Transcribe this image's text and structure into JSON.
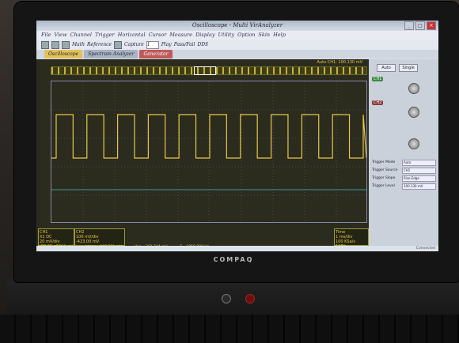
{
  "window": {
    "title": "Oscilloscope - Multi VirAnalyzer"
  },
  "menu": [
    "File",
    "View",
    "Channel",
    "Trigger",
    "Horizontal",
    "Cursor",
    "Measure",
    "Display",
    "Utility",
    "Option",
    "Skin",
    "Help"
  ],
  "toolbar": {
    "math_label": "Math",
    "reference_label": "Reference",
    "capture_label": "Capture",
    "capture_value": "1",
    "play_label": "Play",
    "passfail_label": "Pass/Fail",
    "dds_label": "DDS"
  },
  "tabs": [
    "Oscilloscope",
    "Spectrum Analyzer",
    "Generator"
  ],
  "scope": {
    "trigger_info": "Auto  CH1: 100.130 mV",
    "ch1": {
      "label": "CH1",
      "coupling": "X1  DC",
      "volt_div": "20 mV/div",
      "offset": "-80.00 mV"
    },
    "ch2": {
      "label": "CH2",
      "volt_div": "100 mV/div",
      "offset": "-423.00 mV"
    },
    "time": {
      "label": "Time",
      "time_div": "1 ms/div",
      "rate": "100 KSa/s",
      "mode": "12Bit"
    },
    "measurements": [
      "Vmean= -2.335 mV",
      "Vmax= 108.711 mV",
      "Vpp= 201.244 mV",
      "F= 1060.000 Hz"
    ]
  },
  "side": {
    "auto_label": "Auto",
    "single_label": "Single",
    "ch1_label": "CH1",
    "ch2_label": "CH2",
    "trigger_mode_label": "Trigger Mode",
    "trigger_mode": "Auto",
    "trigger_source_label": "Trigger Source",
    "trigger_source": "CH1",
    "trigger_slope_label": "Trigger Slope",
    "trigger_slope": "Rise Edge",
    "trigger_level_label": "Trigger Level",
    "trigger_level": "100.130 mV"
  },
  "status": "Connected",
  "brand": "COMPAQ",
  "chart_data": {
    "type": "line",
    "series": [
      {
        "name": "CH1",
        "pattern": "square wave",
        "frequency_hz": 1060,
        "vpp_mV": 201.244
      }
    ]
  }
}
